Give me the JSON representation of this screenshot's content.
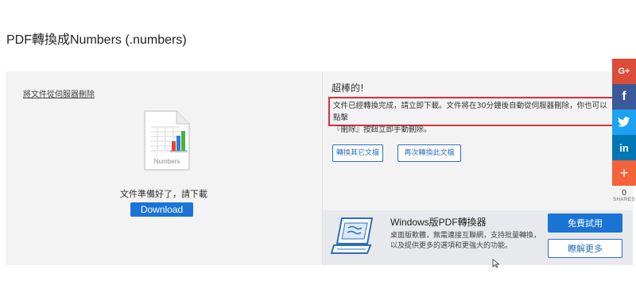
{
  "page": {
    "title": "PDF轉換成Numbers (.numbers)"
  },
  "left": {
    "delete_link": "將文件從伺服器刪除",
    "file_icon_label": "Numbers",
    "ready_text": "文件準備好了，請下載",
    "download_label": "Download"
  },
  "right": {
    "success_title": "超棒的!",
    "notice_line1": "文件已經轉換完成，請立即下載。文件將在30分鐘後自動從伺服器刪除，你也可以點擊",
    "notice_line2": "『刪除』按鈕立即手動刪除。",
    "convert_other_label": "轉換其它文檔",
    "convert_again_label": "再次轉換此文檔"
  },
  "promo": {
    "title": "Windows版PDF轉換器",
    "desc": "桌面版軟體，無需連接互聯網，支持批量轉換，以及提供更多的選項和更強大的功能。",
    "free_trial_label": "免費試用",
    "learn_more_label": "瞭解更多"
  },
  "share": {
    "google_label": "G+",
    "facebook_label": "f",
    "linkedin_label": "in",
    "more_label": "+",
    "count": "0",
    "shares_label": "SHARES",
    "colors": {
      "google": "#dd4b39",
      "facebook": "#3b5998",
      "twitter": "#1da1f2",
      "linkedin": "#0077b5",
      "more": "#f2623b"
    }
  },
  "colors": {
    "primary_blue": "#1a74d6",
    "highlight_red": "#d9303a",
    "panel_bg": "#f3f3f3",
    "promo_bg": "#e8e9ec"
  },
  "icons": [
    "numbers-file-icon",
    "laptop-icon",
    "twitter-icon",
    "cursor-icon"
  ]
}
